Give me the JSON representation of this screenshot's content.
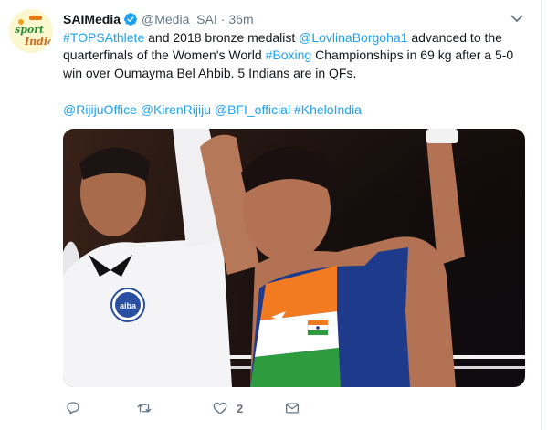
{
  "tweet": {
    "author_name": "SAIMedia",
    "handle": "@Media_SAI",
    "separator": "·",
    "time": "36m",
    "text_parts": {
      "p1": "#TOPSAthlete",
      "p2": " and 2018 bronze medalist ",
      "p3": "@LovlinaBorgoha1",
      "p4": " advanced to the quarterfinals of the Women's World ",
      "p5": "#Boxing",
      "p6": " Championships in 69 kg after a 5-0 win over Oumayma Bel Ahbib. 5 Indians are in QFs."
    },
    "mentions": "@RijijuOffice @KirenRijiju @BFI_official #KheloIndia",
    "avatar_text": {
      "top": "sport",
      "bottom": "India"
    },
    "badge_text": "aiba",
    "like_count": "2"
  },
  "icons": {
    "verified": "verified-badge-icon",
    "caret": "chevron-down-icon",
    "reply": "reply-icon",
    "retweet": "retweet-icon",
    "like": "heart-icon",
    "dm": "envelope-icon"
  },
  "colors": {
    "link": "#1da1f2",
    "muted": "#657786",
    "text": "#14171a"
  }
}
